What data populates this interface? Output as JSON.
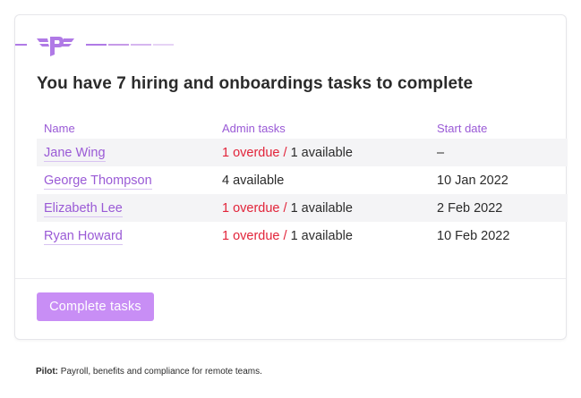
{
  "colors": {
    "accent": "#b07ae6",
    "link": "#9a5ad6",
    "overdue": "#e2243a",
    "button_bg": "#c88ef5",
    "stripe": "#f4f4f6"
  },
  "header": {
    "logo_icon": "pilot-winged-logo-icon",
    "progress_colors": [
      "#b07ae6",
      "#c69ae8",
      "#d6b6ef",
      "#e6d3f5"
    ]
  },
  "headline": {
    "prefix": "You have ",
    "highlight": "7 hiring and onboardings tasks",
    "suffix": " to complete"
  },
  "table": {
    "columns": [
      "Name",
      "Admin tasks",
      "Start date"
    ],
    "rows": [
      {
        "name": "Jane Wing",
        "overdue": "1 overdue /",
        "available": "1 available",
        "start": "–"
      },
      {
        "name": "George Thompson",
        "overdue": "",
        "available": "4 available",
        "start": "10 Jan 2022"
      },
      {
        "name": "Elizabeth Lee",
        "overdue": "1 overdue /",
        "available": "1 available",
        "start": "2 Feb 2022"
      },
      {
        "name": "Ryan Howard",
        "overdue": "1 overdue /",
        "available": "1 available",
        "start": "10 Feb 2022"
      }
    ]
  },
  "action": {
    "button_label": "Complete tasks"
  },
  "footer": {
    "brand": "Pilot:",
    "text": " Payroll, benefits and compliance for remote teams."
  }
}
